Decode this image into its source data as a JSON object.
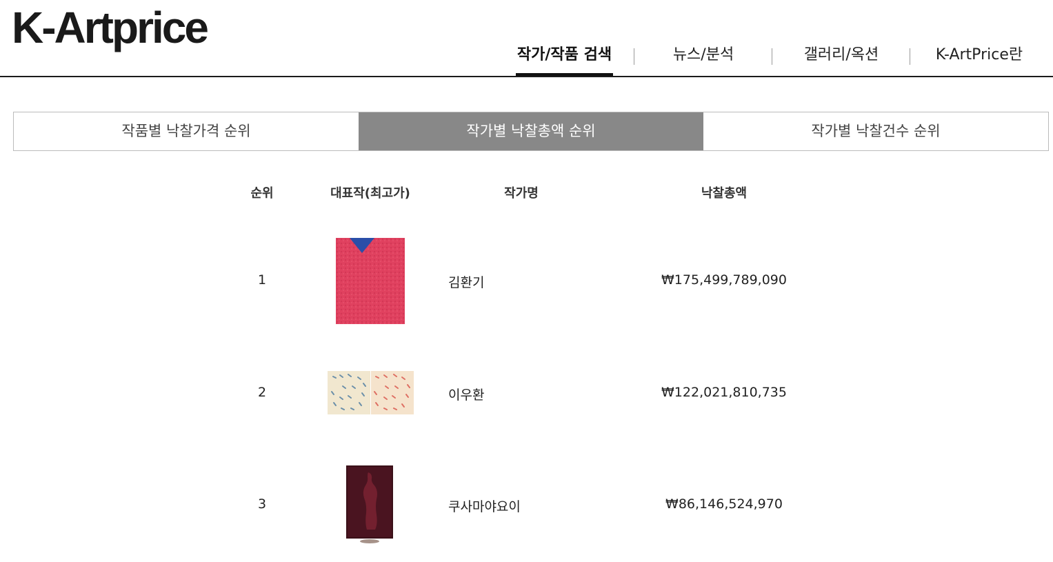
{
  "header": {
    "logo": "K-Artprice",
    "nav": [
      {
        "label": "작가/작품 검색",
        "active": true
      },
      {
        "label": "뉴스/분석",
        "active": false
      },
      {
        "label": "갤러리/옥션",
        "active": false
      },
      {
        "label": "K-ArtPrice란",
        "active": false
      }
    ]
  },
  "tabs": [
    {
      "label": "작품별 낙찰가격 순위",
      "active": false
    },
    {
      "label": "작가별 낙찰총액 순위",
      "active": true
    },
    {
      "label": "작가별 낙찰건수 순위",
      "active": false
    }
  ],
  "table": {
    "columns": [
      "순위",
      "대표작(최고가)",
      "작가명",
      "낙찰총액"
    ],
    "rows": [
      {
        "rank": "1",
        "artist": "김환기",
        "total": "₩175,499,789,090",
        "thumb": "red-painting-with-blue-triangle"
      },
      {
        "rank": "2",
        "artist": "이우환",
        "total": "₩122,021,810,735",
        "thumb": "diptych-swirl-strokes"
      },
      {
        "rank": "3",
        "artist": "쿠사마야요이",
        "total": "₩86,146,524,970",
        "thumb": "dark-red-sculpture"
      }
    ]
  },
  "colors": {
    "active_tab_bg": "#888888",
    "header_rule": "#1a1a1a"
  }
}
